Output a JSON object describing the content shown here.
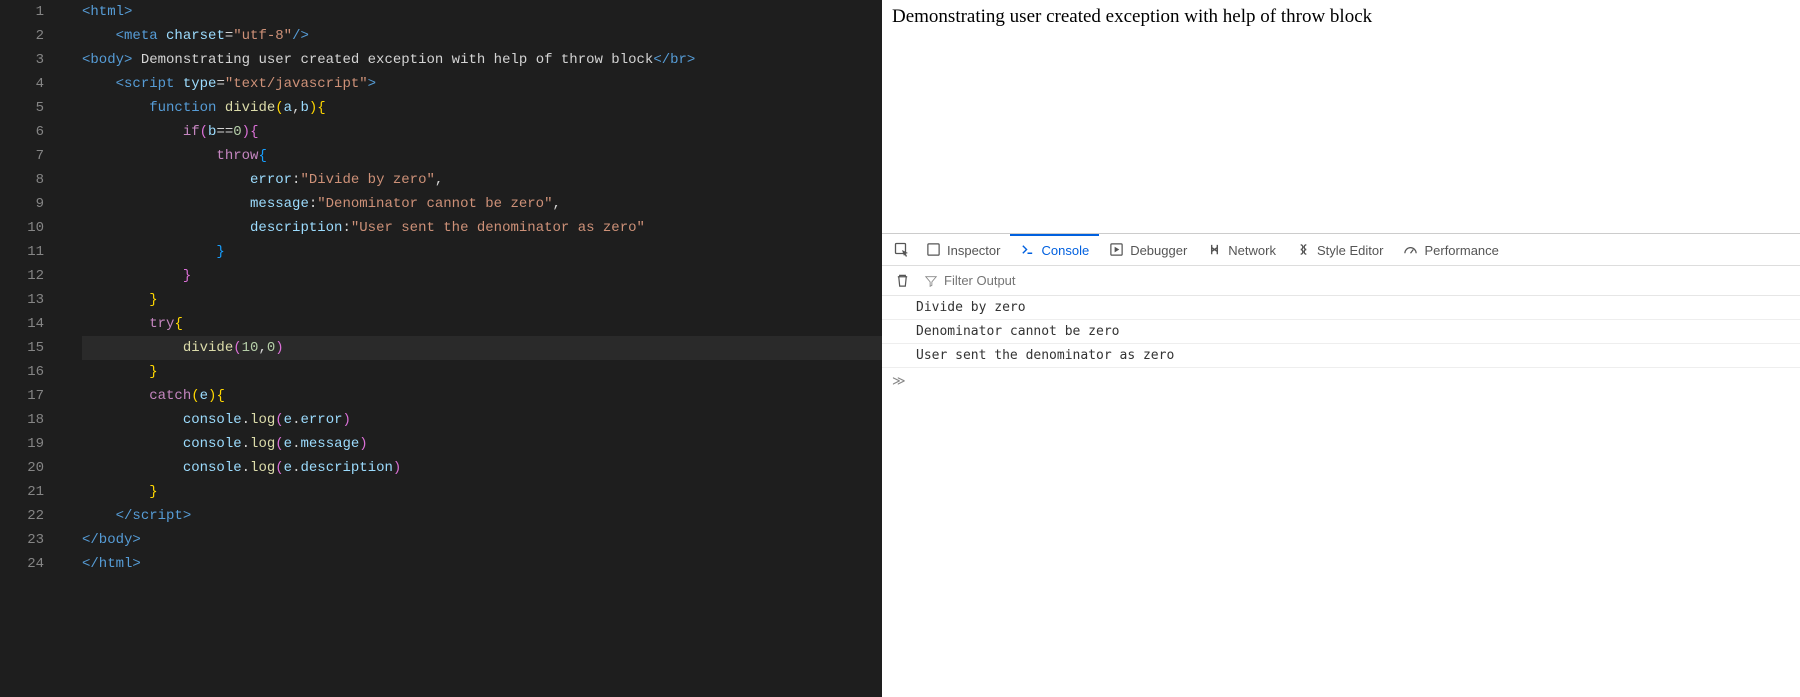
{
  "editor": {
    "highlighted_line": 15,
    "lines": [
      [
        [
          "tag",
          "<html"
        ],
        [
          "tag",
          ">"
        ]
      ],
      [
        [
          "punct",
          "    "
        ],
        [
          "tag",
          "<meta"
        ],
        [
          "punct",
          " "
        ],
        [
          "attr",
          "charset"
        ],
        [
          "punct",
          "="
        ],
        [
          "string",
          "\"utf-8\""
        ],
        [
          "tag",
          "/>"
        ]
      ],
      [
        [
          "tag",
          "<body"
        ],
        [
          "tag",
          ">"
        ],
        [
          "punct",
          " Demonstrating user created exception with help of throw block"
        ],
        [
          "tag",
          "</br>"
        ]
      ],
      [
        [
          "punct",
          "    "
        ],
        [
          "tag",
          "<script"
        ],
        [
          "punct",
          " "
        ],
        [
          "attr",
          "type"
        ],
        [
          "punct",
          "="
        ],
        [
          "string",
          "\"text/javascript\""
        ],
        [
          "tag",
          ">"
        ]
      ],
      [
        [
          "punct",
          "        "
        ],
        [
          "keyword2",
          "function"
        ],
        [
          "punct",
          " "
        ],
        [
          "func",
          "divide"
        ],
        [
          "bracket1",
          "("
        ],
        [
          "ident",
          "a"
        ],
        [
          "punct",
          ","
        ],
        [
          "ident",
          "b"
        ],
        [
          "bracket1",
          ")"
        ],
        [
          "bracket1",
          "{"
        ]
      ],
      [
        [
          "punct",
          "            "
        ],
        [
          "keyword",
          "if"
        ],
        [
          "bracket2",
          "("
        ],
        [
          "ident",
          "b"
        ],
        [
          "punct",
          "=="
        ],
        [
          "number",
          "0"
        ],
        [
          "bracket2",
          ")"
        ],
        [
          "bracket2",
          "{"
        ]
      ],
      [
        [
          "punct",
          "                "
        ],
        [
          "keyword",
          "throw"
        ],
        [
          "bracket3",
          "{"
        ]
      ],
      [
        [
          "punct",
          "                    "
        ],
        [
          "prop",
          "error"
        ],
        [
          "punct",
          ":"
        ],
        [
          "string",
          "\"Divide by zero\""
        ],
        [
          "punct",
          ","
        ]
      ],
      [
        [
          "punct",
          "                    "
        ],
        [
          "prop",
          "message"
        ],
        [
          "punct",
          ":"
        ],
        [
          "string",
          "\"Denominator cannot be zero\""
        ],
        [
          "punct",
          ","
        ]
      ],
      [
        [
          "punct",
          "                    "
        ],
        [
          "prop",
          "description"
        ],
        [
          "punct",
          ":"
        ],
        [
          "string",
          "\"User sent the denominator as zero\""
        ]
      ],
      [
        [
          "punct",
          "                "
        ],
        [
          "bracket3",
          "}"
        ]
      ],
      [
        [
          "punct",
          "            "
        ],
        [
          "bracket2",
          "}"
        ]
      ],
      [
        [
          "punct",
          "        "
        ],
        [
          "bracket1",
          "}"
        ]
      ],
      [
        [
          "punct",
          "        "
        ],
        [
          "keyword",
          "try"
        ],
        [
          "bracket1",
          "{"
        ]
      ],
      [
        [
          "punct",
          "            "
        ],
        [
          "func",
          "divide"
        ],
        [
          "bracket2",
          "("
        ],
        [
          "number",
          "10"
        ],
        [
          "punct",
          ","
        ],
        [
          "number",
          "0"
        ],
        [
          "bracket2",
          ")"
        ]
      ],
      [
        [
          "punct",
          "        "
        ],
        [
          "bracket1",
          "}"
        ]
      ],
      [
        [
          "punct",
          "        "
        ],
        [
          "keyword",
          "catch"
        ],
        [
          "bracket1",
          "("
        ],
        [
          "ident",
          "e"
        ],
        [
          "bracket1",
          ")"
        ],
        [
          "bracket1",
          "{"
        ]
      ],
      [
        [
          "punct",
          "            "
        ],
        [
          "ident",
          "console"
        ],
        [
          "punct",
          "."
        ],
        [
          "func",
          "log"
        ],
        [
          "bracket2",
          "("
        ],
        [
          "ident",
          "e"
        ],
        [
          "punct",
          "."
        ],
        [
          "prop",
          "error"
        ],
        [
          "bracket2",
          ")"
        ]
      ],
      [
        [
          "punct",
          "            "
        ],
        [
          "ident",
          "console"
        ],
        [
          "punct",
          "."
        ],
        [
          "func",
          "log"
        ],
        [
          "bracket2",
          "("
        ],
        [
          "ident",
          "e"
        ],
        [
          "punct",
          "."
        ],
        [
          "prop",
          "message"
        ],
        [
          "bracket2",
          ")"
        ]
      ],
      [
        [
          "punct",
          "            "
        ],
        [
          "ident",
          "console"
        ],
        [
          "punct",
          "."
        ],
        [
          "func",
          "log"
        ],
        [
          "bracket2",
          "("
        ],
        [
          "ident",
          "e"
        ],
        [
          "punct",
          "."
        ],
        [
          "prop",
          "description"
        ],
        [
          "bracket2",
          ")"
        ]
      ],
      [
        [
          "punct",
          "        "
        ],
        [
          "bracket1",
          "}"
        ]
      ],
      [
        [
          "punct",
          "    "
        ],
        [
          "tag",
          "</script"
        ],
        [
          "tag",
          ">"
        ]
      ],
      [
        [
          "tag",
          "</body"
        ],
        [
          "tag",
          ">"
        ]
      ],
      [
        [
          "tag",
          "</html"
        ],
        [
          "tag",
          ">"
        ]
      ]
    ]
  },
  "page": {
    "body_text": "Demonstrating user created exception with help of throw block"
  },
  "devtools": {
    "tabs": [
      {
        "id": "inspector",
        "label": "Inspector"
      },
      {
        "id": "console",
        "label": "Console"
      },
      {
        "id": "debugger",
        "label": "Debugger"
      },
      {
        "id": "network",
        "label": "Network"
      },
      {
        "id": "style",
        "label": "Style Editor"
      },
      {
        "id": "performance",
        "label": "Performance"
      }
    ],
    "active_tab": "console",
    "filter_placeholder": "Filter Output",
    "console_output": [
      "Divide by zero",
      "Denominator cannot be zero",
      "User sent the denominator as zero"
    ],
    "prompt_symbol": "≫"
  }
}
